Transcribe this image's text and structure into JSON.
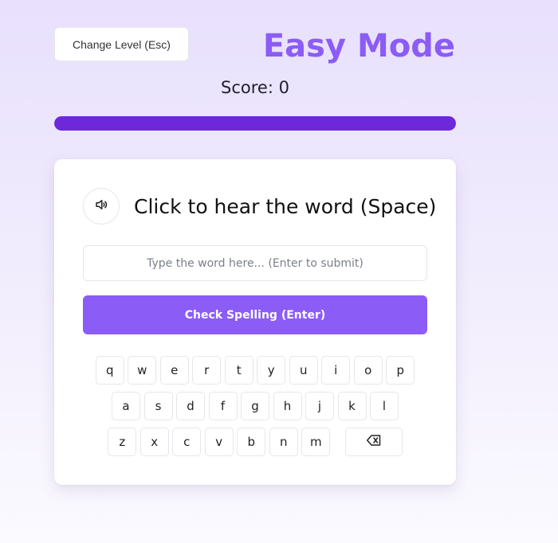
{
  "header": {
    "change_level_label": "Change Level (Esc)",
    "mode_title": "Easy Mode",
    "score_label": "Score: 0",
    "progress_fraction": 1.0
  },
  "card": {
    "audio_prompt": "Click to hear the word (Space)",
    "speaker_icon": "speaker-icon",
    "input_placeholder": "Type the word here... (Enter to submit)",
    "input_value": "",
    "check_label": "Check Spelling (Enter)"
  },
  "keyboard": {
    "row1": [
      "q",
      "w",
      "e",
      "r",
      "t",
      "y",
      "u",
      "i",
      "o",
      "p"
    ],
    "row2": [
      "a",
      "s",
      "d",
      "f",
      "g",
      "h",
      "j",
      "k",
      "l"
    ],
    "row3": [
      "z",
      "x",
      "c",
      "v",
      "b",
      "n",
      "m"
    ],
    "backspace_icon": "backspace-icon"
  },
  "colors": {
    "accent": "#8b5cf6",
    "progress": "#6d28d9",
    "background": "#ece4fd"
  }
}
